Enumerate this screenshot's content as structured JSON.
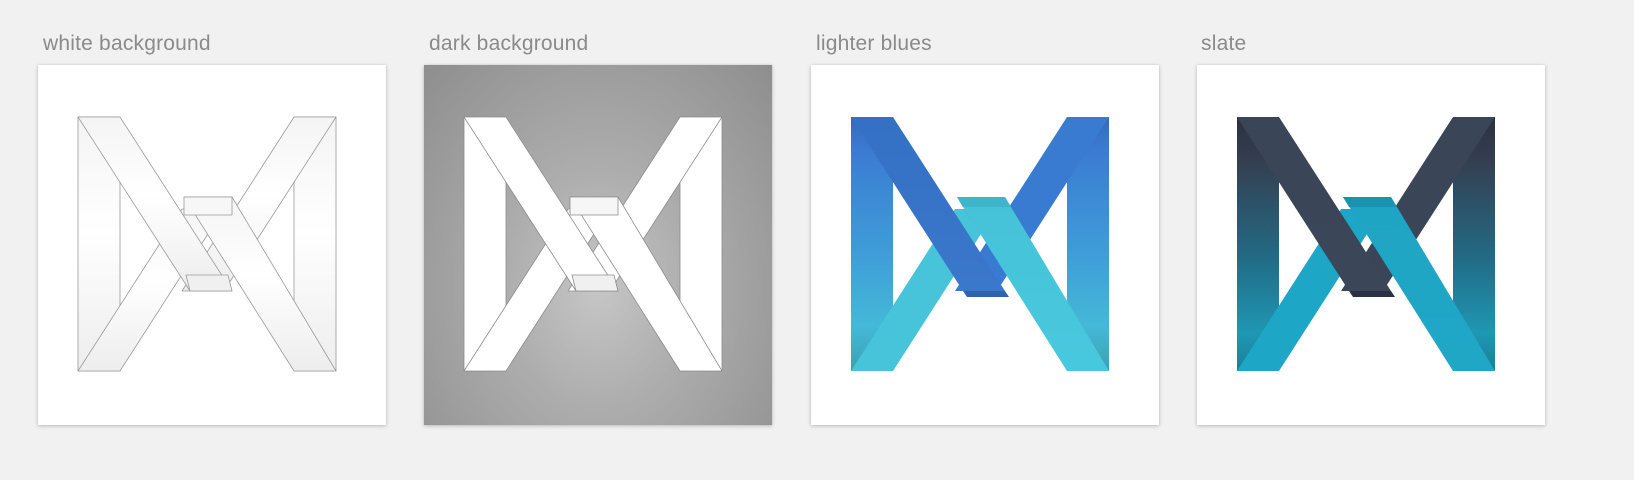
{
  "artboards": [
    {
      "label": "white background",
      "logo": "white-outline"
    },
    {
      "label": "dark background",
      "logo": "white-on-gray"
    },
    {
      "label": "lighter blues",
      "logo": "blue-gradient"
    },
    {
      "label": "slate",
      "logo": "slate-teal-gradient"
    }
  ],
  "colors": {
    "page_background": "#f1f1f1",
    "label_text": "#8a8a8a",
    "canvas_background": "#ffffff",
    "dark_canvas_center": "#c6c6c6",
    "dark_canvas_edge": "#8e8e8e",
    "light_blue_top": "#3b79cf",
    "light_blue_bottom": "#46c6dc",
    "slate_top": "#2c3444",
    "slate_bottom": "#1ea2c2"
  },
  "icons": [
    "m-logo-outline",
    "m-logo-white",
    "m-logo-blue",
    "m-logo-slate"
  ]
}
